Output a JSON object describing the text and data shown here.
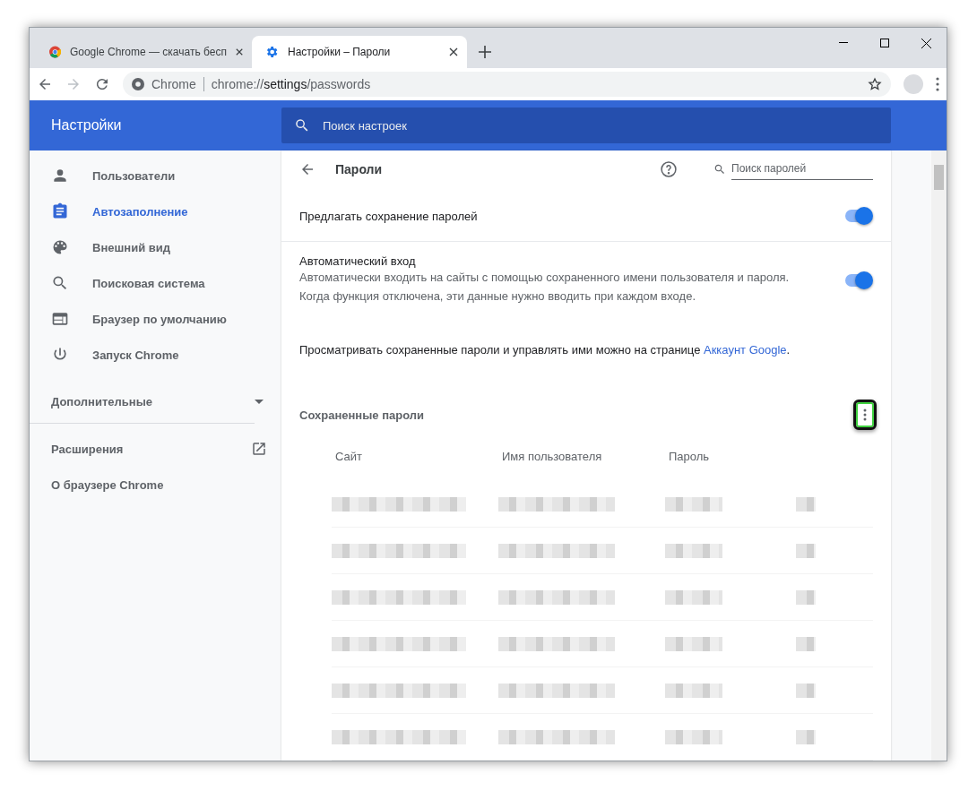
{
  "tabs": [
    {
      "title": "Google Chrome — скачать бесп",
      "selected": false
    },
    {
      "title": "Настройки – Пароли",
      "selected": true
    }
  ],
  "address_bar": {
    "site_label": "Chrome",
    "url_prefix": "chrome://",
    "url_host": "settings",
    "url_path": "/passwords"
  },
  "header": {
    "title": "Настройки",
    "search_placeholder": "Поиск настроек"
  },
  "sidebar": {
    "items": [
      {
        "label": "Пользователи",
        "selected": false
      },
      {
        "label": "Автозаполнение",
        "selected": true
      },
      {
        "label": "Внешний вид",
        "selected": false
      },
      {
        "label": "Поисковая система",
        "selected": false
      },
      {
        "label": "Браузер по умолчанию",
        "selected": false
      },
      {
        "label": "Запуск Chrome",
        "selected": false
      }
    ],
    "advanced": {
      "label": "Дополнительные",
      "expanded": false
    },
    "links": [
      {
        "label": "Расширения",
        "external": true
      },
      {
        "label": "О браузере Chrome",
        "external": false
      }
    ]
  },
  "page": {
    "title": "Пароли",
    "search_placeholder": "Поиск паролей",
    "settings": [
      {
        "title": "Предлагать сохранение паролей",
        "on": true
      },
      {
        "title": "Автоматический вход",
        "description": [
          "Автоматически входить на сайты с помощью сохраненного имени пользователя и пароля.",
          "Когда функция отключена, эти данные нужно вводить при каждом входе."
        ],
        "on": true
      }
    ],
    "note": {
      "text": "Просматривать сохраненные пароли и управлять ими можно на странице ",
      "link": "Аккаунт Google",
      "suffix": "."
    },
    "saved": {
      "title": "Сохраненные пароли",
      "menu_highlighted": true,
      "columns": [
        "Сайт",
        "Имя пользователя",
        "Пароль"
      ],
      "rows": [
        {
          "kind": "redacted"
        },
        {
          "kind": "redacted"
        },
        {
          "kind": "redacted"
        },
        {
          "kind": "redacted"
        },
        {
          "kind": "redacted"
        },
        {
          "kind": "redacted"
        }
      ]
    }
  }
}
